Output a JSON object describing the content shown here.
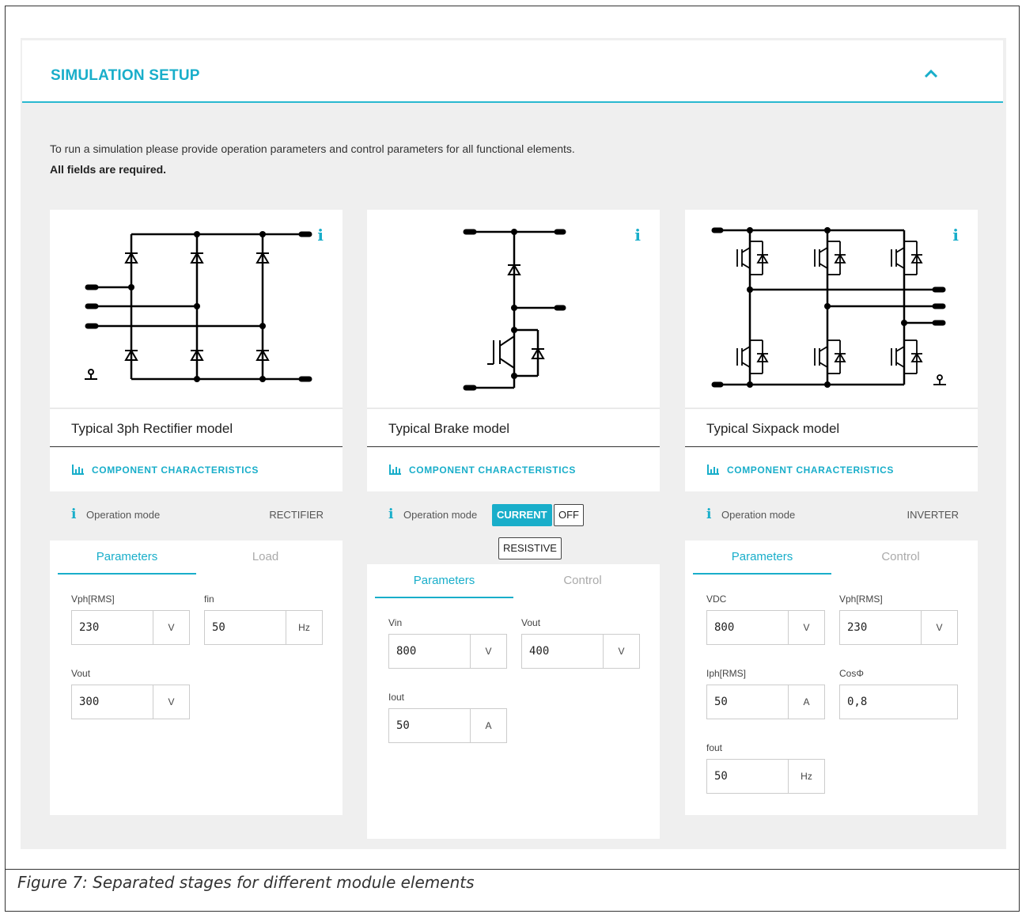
{
  "panel": {
    "title": "SIMULATION SETUP",
    "intro": "To run a simulation please provide operation parameters and control parameters for all functional elements.",
    "required": "All fields are required."
  },
  "icons": {
    "info": "i",
    "collapse": "chevron-up-icon",
    "characteristics": "bar-chart-icon"
  },
  "cards": [
    {
      "title": "Typical 3ph Rectifier model",
      "component_characteristics": "COMPONENT CHARACTERISTICS",
      "operation_mode_label": "Operation mode",
      "operation_mode_value": "RECTIFIER",
      "tabs": [
        "Parameters",
        "Load"
      ],
      "fields": [
        {
          "label": "Vph[RMS]",
          "value": "230",
          "unit": "V"
        },
        {
          "label": "fin",
          "value": "50",
          "unit": "Hz"
        },
        {
          "label": "Vout",
          "value": "300",
          "unit": "V"
        }
      ]
    },
    {
      "title": "Typical Brake model",
      "component_characteristics": "COMPONENT CHARACTERISTICS",
      "operation_mode_label": "Operation mode",
      "modes": [
        "CURRENT",
        "OFF",
        "RESISTIVE"
      ],
      "active_mode": "CURRENT",
      "tabs": [
        "Parameters",
        "Control"
      ],
      "fields": [
        {
          "label": "Vin",
          "value": "800",
          "unit": "V"
        },
        {
          "label": "Vout",
          "value": "400",
          "unit": "V"
        },
        {
          "label": "Iout",
          "value": "50",
          "unit": "A"
        }
      ]
    },
    {
      "title": "Typical Sixpack model",
      "component_characteristics": "COMPONENT CHARACTERISTICS",
      "operation_mode_label": "Operation mode",
      "operation_mode_value": "INVERTER",
      "tabs": [
        "Parameters",
        "Control"
      ],
      "fields": [
        {
          "label": "VDC",
          "value": "800",
          "unit": "V"
        },
        {
          "label": "Vph[RMS]",
          "value": "230",
          "unit": "V"
        },
        {
          "label": "Iph[RMS]",
          "value": "50",
          "unit": "A"
        },
        {
          "label": "CosΦ",
          "value": "0,8",
          "unit": ""
        },
        {
          "label": "fout",
          "value": "50",
          "unit": "Hz"
        }
      ]
    }
  ],
  "caption": "Figure 7: Separated stages for different module elements",
  "colors": {
    "accent": "#19aeca",
    "panel_bg": "#efefef"
  }
}
